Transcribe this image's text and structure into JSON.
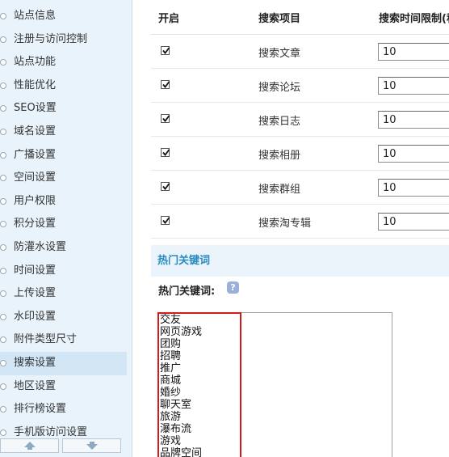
{
  "sidebar": {
    "items": [
      {
        "label": "站点信息"
      },
      {
        "label": "注册与访问控制"
      },
      {
        "label": "站点功能"
      },
      {
        "label": "性能优化"
      },
      {
        "label": "SEO设置"
      },
      {
        "label": "域名设置"
      },
      {
        "label": "广播设置"
      },
      {
        "label": "空间设置"
      },
      {
        "label": "用户权限"
      },
      {
        "label": "积分设置"
      },
      {
        "label": "防灌水设置"
      },
      {
        "label": "时间设置"
      },
      {
        "label": "上传设置"
      },
      {
        "label": "水印设置"
      },
      {
        "label": "附件类型尺寸"
      },
      {
        "label": "搜索设置"
      },
      {
        "label": "地区设置"
      },
      {
        "label": "排行榜设置"
      },
      {
        "label": "手机版访问设置"
      }
    ],
    "active_index": 15,
    "scroll_up_icon": "arrow-up-icon",
    "scroll_down_icon": "arrow-down-icon"
  },
  "table": {
    "headers": {
      "enable": "开启",
      "item": "搜索项目",
      "limit": "搜索时间限制(秒)"
    },
    "rows": [
      {
        "label": "搜索文章",
        "checked": true,
        "value": "10"
      },
      {
        "label": "搜索论坛",
        "checked": true,
        "value": "10"
      },
      {
        "label": "搜索日志",
        "checked": true,
        "value": "10"
      },
      {
        "label": "搜索相册",
        "checked": true,
        "value": "10"
      },
      {
        "label": "搜索群组",
        "checked": true,
        "value": "10"
      },
      {
        "label": "搜索淘专辑",
        "checked": true,
        "value": "10"
      }
    ]
  },
  "hot_keywords": {
    "section_title": "热门关键词",
    "field_label": "热门关键词:",
    "help_icon": "help-icon",
    "keywords": [
      "交友",
      "网页游戏",
      "团购",
      "招聘",
      "推广",
      "商城",
      "婚纱",
      "聊天室",
      "旅游",
      "瀑布流",
      "游戏",
      "品牌空间"
    ]
  },
  "colors": {
    "sidebar_bg": "#e8f3fb",
    "section_title": "#2a8bc1",
    "highlight_border": "#d61a1a"
  }
}
